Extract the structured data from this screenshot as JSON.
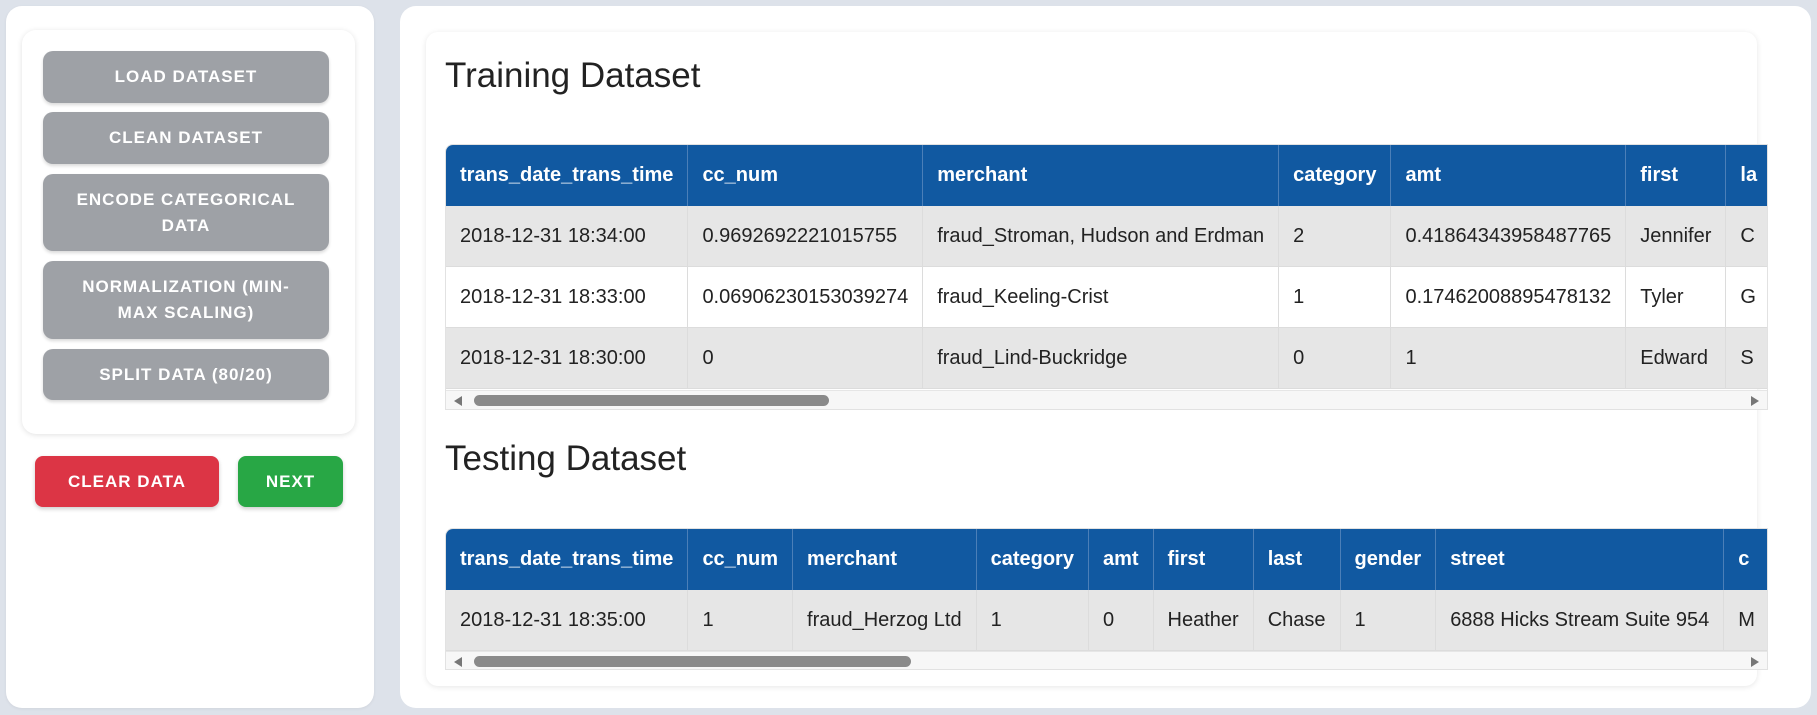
{
  "sidebar": {
    "buttons": [
      {
        "label": "LOAD DATASET"
      },
      {
        "label": "CLEAN DATASET"
      },
      {
        "label": "ENCODE CATEGORICAL DATA"
      },
      {
        "label": "NORMALIZATION (MIN-MAX SCALING)"
      },
      {
        "label": "SPLIT DATA (80/20)"
      }
    ],
    "clear_label": "CLEAR DATA",
    "next_label": "NEXT"
  },
  "colors": {
    "header_blue": "#1159a1",
    "button_gray": "#9ea1a6",
    "clear_red": "#dc3545",
    "next_green": "#28a745"
  },
  "training": {
    "title": "Training Dataset",
    "headers": [
      "trans_date_trans_time",
      "cc_num",
      "merchant",
      "category",
      "amt",
      "first",
      "la"
    ],
    "rows": [
      [
        "2018-12-31 18:34:00",
        "0.9692692221015755",
        "fraud_Stroman, Hudson and Erdman",
        "2",
        "0.41864343958487765",
        "Jennifer",
        "C"
      ],
      [
        "2018-12-31 18:33:00",
        "0.06906230153039274",
        "fraud_Keeling-Crist",
        "1",
        "0.17462008895478132",
        "Tyler",
        "G"
      ],
      [
        "2018-12-31 18:30:00",
        "0",
        "fraud_Lind-Buckridge",
        "0",
        "1",
        "Edward",
        "S"
      ]
    ]
  },
  "testing": {
    "title": "Testing Dataset",
    "headers": [
      "trans_date_trans_time",
      "cc_num",
      "merchant",
      "category",
      "amt",
      "first",
      "last",
      "gender",
      "street",
      "c"
    ],
    "rows": [
      [
        "2018-12-31 18:35:00",
        "1",
        "fraud_Herzog Ltd",
        "1",
        "0",
        "Heather",
        "Chase",
        "1",
        "6888 Hicks Stream Suite 954",
        "M"
      ]
    ]
  }
}
